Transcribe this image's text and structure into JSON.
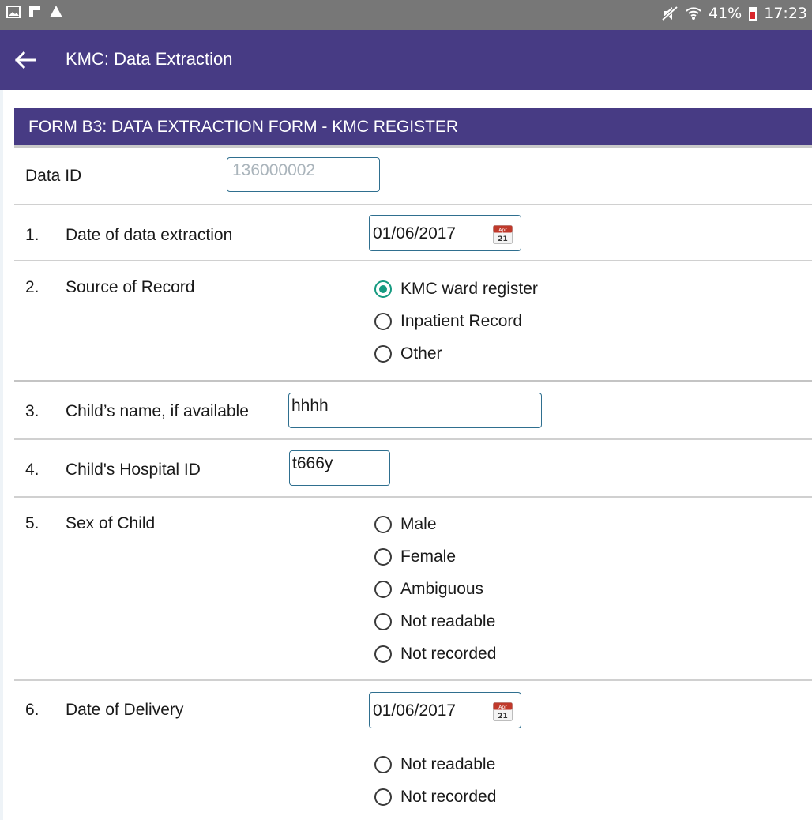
{
  "status_bar": {
    "battery": "41%",
    "time": "17:23"
  },
  "app_bar": {
    "title": "KMC: Data Extraction"
  },
  "form": {
    "header": "FORM B3: DATA EXTRACTION FORM - KMC REGISTER",
    "data_id": {
      "label": "Data ID",
      "value": "136000002"
    },
    "q1": {
      "num": "1.",
      "label": "Date of  data extraction",
      "value": "01/06/2017"
    },
    "q2": {
      "num": "2.",
      "label": "Source of Record",
      "options": [
        "KMC ward register",
        "Inpatient  Record",
        "Other"
      ],
      "selected": "KMC ward register"
    },
    "q3": {
      "num": "3.",
      "label": "Child’s name, if available",
      "value": "hhhh"
    },
    "q4": {
      "num": "4.",
      "label": "Child's Hospital ID",
      "value": "t666y"
    },
    "q5": {
      "num": "5.",
      "label": "Sex of Child",
      "options": [
        "Male",
        "Female",
        "Ambiguous",
        "Not readable",
        "Not recorded"
      ]
    },
    "q6": {
      "num": "6.",
      "label": "Date of Delivery",
      "value": "01/06/2017",
      "options": [
        "Not readable",
        "Not recorded"
      ]
    },
    "calendar_icon": {
      "month": "Apr",
      "day": "21"
    }
  },
  "colors": {
    "brand": "#473b84",
    "radio_checked": "#159a80",
    "field_border": "#2f6f8f"
  }
}
